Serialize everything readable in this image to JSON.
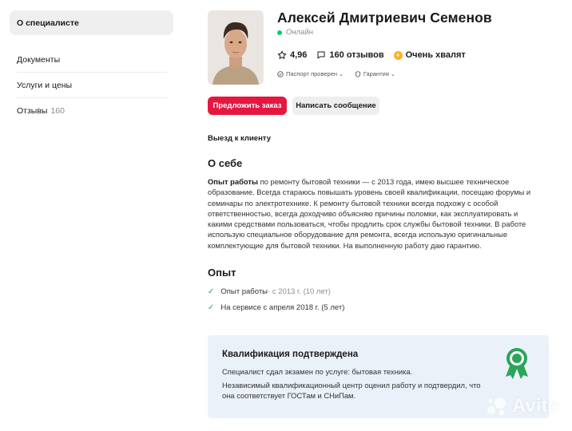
{
  "sidebar": {
    "items": [
      {
        "label": "О специалисте",
        "active": true
      },
      {
        "label": "Документы"
      },
      {
        "label": "Услуги и цены"
      },
      {
        "label": "Отзывы",
        "count": "160"
      }
    ]
  },
  "profile": {
    "name": "Алексей Дмитриевич Семенов",
    "status": "Онлайн",
    "rating": "4,96",
    "reviews": "160 отзывов",
    "praise": "Очень хвалят",
    "badge_passport": "Паспорт проверен",
    "badge_guarantee": "Гарантия",
    "status_color": "#02d15c",
    "praise_color": "#ffb021"
  },
  "actions": {
    "order_label": "Предложить заказ",
    "message_label": "Написать сообщение",
    "primary_color": "#e5173f"
  },
  "visit": "Выезд к клиенту",
  "about": {
    "title": "О себе",
    "lead": "Опыт работы",
    "text": " по ремонту бытовой техники — с 2013 года, имею высшее техническое образование. Всегда стараюсь повышать уровень своей квалификации, посещаю форумы и семинары по электротехнике. К ремонту бытовой техники всегда подхожу с особой ответственностью, всегда доходчиво объясняю причины поломки, как эксплуатировать и какими средствами пользоваться, чтобы продлить срок службы бытовой техники. В работе использую специальное оборудование для ремонта, всегда использую оригинальные комплектующие для бытовой техники. На выполненную работу даю гарантию."
  },
  "experience": {
    "title": "Опыт",
    "items": [
      {
        "label": "Опыт работы",
        "detail": " · с 2013 г. (10 лет)"
      },
      {
        "label": "На сервисе с апреля 2018 г. (5 лет)"
      }
    ],
    "check_color": "#2aa55a"
  },
  "qualification": {
    "title": "Квалификация подтверждена",
    "line1": "Специалист сдал экзамен по услуге: бытовая техника.",
    "line2": "Независимый квалификационный центр оценил работу и подтвердил, что она соответствует ГОСТам и СНиПам.",
    "medal_color": "#2aa55a",
    "bg_color": "#eaf1f9"
  },
  "watermark": {
    "text": "Avito"
  }
}
